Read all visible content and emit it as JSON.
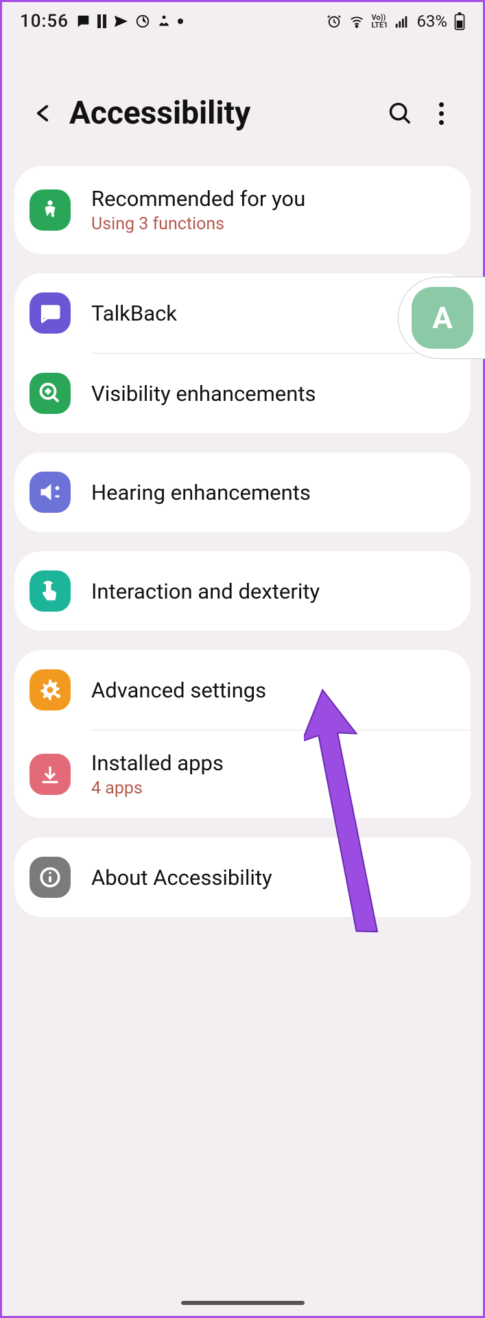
{
  "status": {
    "time": "10:56",
    "battery": "63%"
  },
  "header": {
    "title": "Accessibility"
  },
  "groups": [
    {
      "items": [
        {
          "name": "recommended",
          "title": "Recommended for you",
          "sub": "Using 3 functions",
          "iconBg": "bg-green",
          "icon": "person-heart"
        }
      ]
    },
    {
      "items": [
        {
          "name": "talkback",
          "title": "TalkBack",
          "iconBg": "bg-purple",
          "icon": "speech"
        },
        {
          "name": "visibility",
          "title": "Visibility enhancements",
          "iconBg": "bg-green",
          "icon": "magnify-plus"
        }
      ]
    },
    {
      "items": [
        {
          "name": "hearing",
          "title": "Hearing enhancements",
          "iconBg": "bg-indigo",
          "icon": "volume-adjust"
        }
      ]
    },
    {
      "items": [
        {
          "name": "interaction",
          "title": "Interaction and dexterity",
          "iconBg": "bg-teal",
          "icon": "touch"
        }
      ]
    },
    {
      "items": [
        {
          "name": "advanced",
          "title": "Advanced settings",
          "iconBg": "bg-orange",
          "icon": "gear-plus"
        },
        {
          "name": "installed",
          "title": "Installed apps",
          "sub": "4 apps",
          "iconBg": "bg-rose",
          "icon": "download"
        }
      ]
    },
    {
      "items": [
        {
          "name": "about",
          "title": "About Accessibility",
          "iconBg": "bg-gray",
          "icon": "info"
        }
      ]
    }
  ],
  "floatBadge": {
    "letter": "A"
  }
}
